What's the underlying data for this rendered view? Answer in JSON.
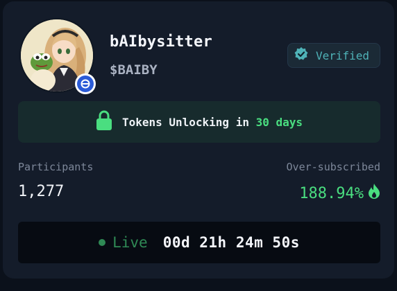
{
  "token": {
    "name": "bAIbysitter",
    "ticker": "$BAIBY",
    "avatar_icon": "anime-girl-with-frog-avatar",
    "chain_badge_icon": "chain-badge-icon"
  },
  "verified": {
    "label": "Verified",
    "icon": "verified-badge-icon",
    "color": "#4fb3b8"
  },
  "unlock": {
    "prefix": "Tokens Unlocking in",
    "days": "30 days",
    "icon": "lock-icon",
    "accent": "#4ade80"
  },
  "stats": {
    "participants_label": "Participants",
    "participants_value": "1,277",
    "oversubscribed_label": "Over-subscribed",
    "oversubscribed_value": "188.94%",
    "oversubscribed_icon": "flame-icon"
  },
  "status": {
    "live_label": "Live",
    "countdown": "00d 21h 24m 50s"
  }
}
